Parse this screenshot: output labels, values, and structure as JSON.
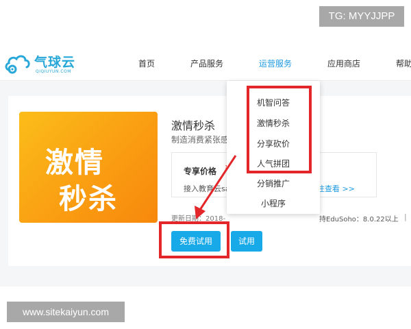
{
  "watermark_top": "TG: MYYJJPP",
  "watermark_bottom": "www.sitekaiyun.com",
  "logo": {
    "name": "气球云",
    "sub": "QIQIUYUN.COM"
  },
  "nav": [
    {
      "label": "首页"
    },
    {
      "label": "产品服务"
    },
    {
      "label": "运营服务"
    },
    {
      "label": "应用商店"
    },
    {
      "label": "帮助"
    }
  ],
  "dropdown": {
    "items": [
      "机智问答",
      "激情秒杀",
      "分享砍价",
      "人气拼团",
      "分销推广",
      "小程序"
    ]
  },
  "product": {
    "image_text_line1": "激情",
    "image_text_line2": "秒杀",
    "title": "激情秒杀",
    "subtitle": "制造消费紧张感",
    "price_label": "专享价格",
    "price_mark": "¥",
    "support_text": "接入教育云sa",
    "view_link": "注查看 >>",
    "update_date": "更新日期：2018-",
    "compat_text": "持EduSoho：8.0.22以上",
    "separator": "|"
  },
  "buttons": {
    "free_trial": "免费试用",
    "trial": "试用"
  },
  "colors": {
    "accent": "#18a9e8",
    "highlight_box": "#e2262a",
    "product_orange": "#fa9e12"
  }
}
